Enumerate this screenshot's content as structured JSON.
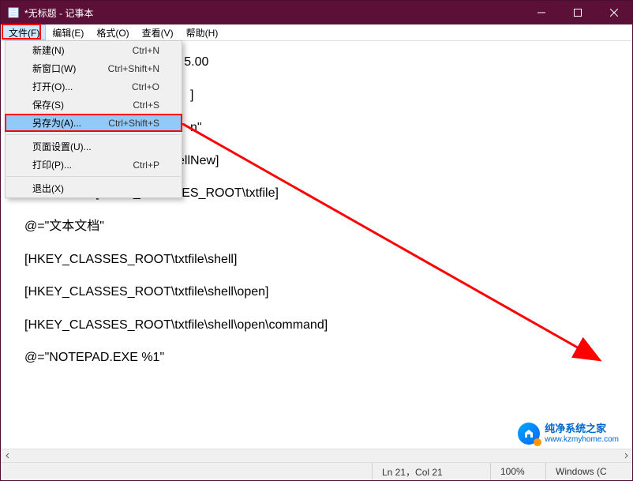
{
  "titlebar": {
    "title": "*无标题 - 记事本"
  },
  "menubar": {
    "file": "文件(F)",
    "edit": "编辑(E)",
    "format": "格式(O)",
    "view": "查看(V)",
    "help": "帮助(H)"
  },
  "dropdown": {
    "new": {
      "label": "新建(N)",
      "shortcut": "Ctrl+N"
    },
    "newwin": {
      "label": "新窗口(W)",
      "shortcut": "Ctrl+Shift+N"
    },
    "open": {
      "label": "打开(O)...",
      "shortcut": "Ctrl+O"
    },
    "save": {
      "label": "保存(S)",
      "shortcut": "Ctrl+S"
    },
    "saveas": {
      "label": "另存为(A)...",
      "shortcut": "Ctrl+Shift+S"
    },
    "pagesetup": {
      "label": "页面设置(U)...",
      "shortcut": ""
    },
    "print": {
      "label": "打印(P)...",
      "shortcut": "Ctrl+P"
    },
    "exit": {
      "label": "退出(X)",
      "shortcut": ""
    }
  },
  "content": {
    "l1": "on 5.00",
    "l2": "]",
    "l3": "",
    "l4": "n\"",
    "l5": "\\ShellNew]",
    "l6": "\"NullFile\"=\"\" [HKEY_CLASSES_ROOT\\txtfile]",
    "l7": "@=\"文本文档\"",
    "l8": "[HKEY_CLASSES_ROOT\\txtfile\\shell]",
    "l9": "[HKEY_CLASSES_ROOT\\txtfile\\shell\\open]",
    "l10": "[HKEY_CLASSES_ROOT\\txtfile\\shell\\open\\command]",
    "l11": "@=\"NOTEPAD.EXE %1\""
  },
  "statusbar": {
    "pos": "Ln 21，Col 21",
    "zoom": "100%",
    "eol": "Windows (C",
    "enc": ""
  },
  "watermark": {
    "line1": "纯净系统之家",
    "line2": "www.kzmyhome.com"
  }
}
